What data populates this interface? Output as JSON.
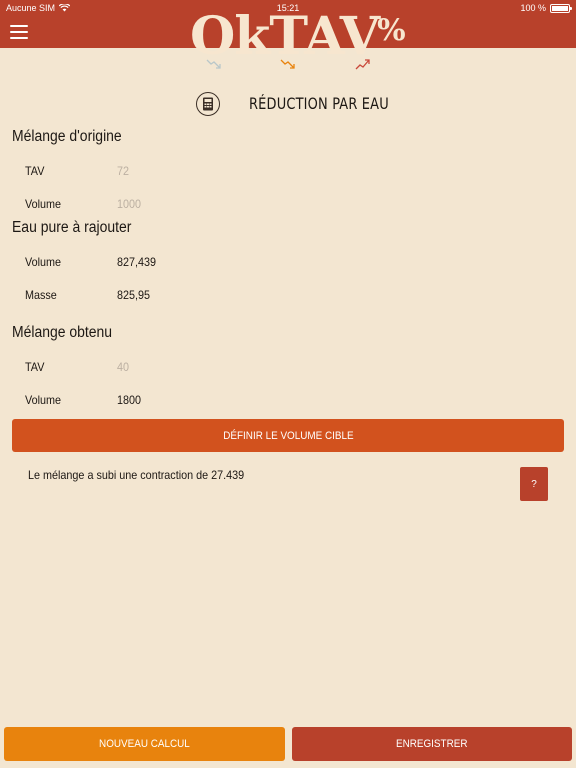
{
  "status_bar": {
    "carrier": "Aucune SIM",
    "time": "15:21",
    "battery": "100 %"
  },
  "app": {
    "logo_text": "OkTAV",
    "logo_suffix": "%"
  },
  "colors": {
    "accent": "#b8412b",
    "primary_button": "#d2521e",
    "secondary_button": "#e8830d",
    "background": "#f3e6d1"
  },
  "mode_icons": [
    "arrow-down-right-light-icon",
    "arrow-down-right-orange-icon",
    "arrow-up-right-red-icon"
  ],
  "page": {
    "title": "RÉDUCTION PAR EAU"
  },
  "origin": {
    "title": "Mélange d'origine",
    "tav_label": "TAV",
    "tav_placeholder": "72",
    "volume_label": "Volume",
    "volume_placeholder": "1000"
  },
  "water": {
    "title": "Eau pure à rajouter",
    "volume_label": "Volume",
    "volume_value": "827,439",
    "mass_label": "Masse",
    "mass_value": "825,95"
  },
  "result": {
    "title": "Mélange obtenu",
    "tav_label": "TAV",
    "tav_placeholder": "40",
    "volume_label": "Volume",
    "volume_value": "1800"
  },
  "actions": {
    "target_volume_label": "DÉFINIR LE VOLUME CIBLE",
    "contraction_text": "Le mélange a subi une contraction de 27.439",
    "help_label": "?",
    "new_calc_label": "NOUVEAU CALCUL",
    "save_label": "ENREGISTRER"
  }
}
